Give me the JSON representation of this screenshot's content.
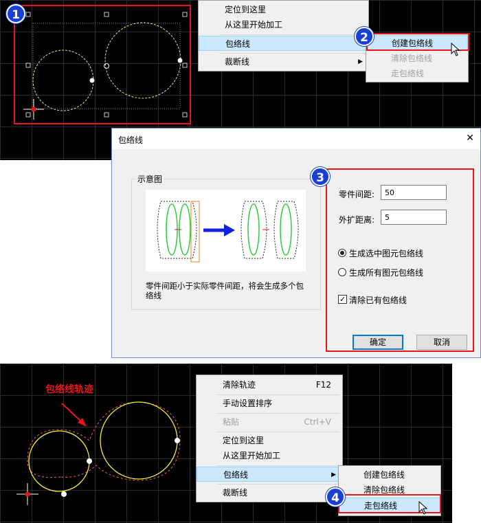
{
  "badges": [
    "1",
    "2",
    "3",
    "4"
  ],
  "top_menu": {
    "items": [
      {
        "label": "定位到这里"
      },
      {
        "label": "从这里开始加工"
      },
      {
        "label": "包络线"
      },
      {
        "label": "裁断线"
      }
    ]
  },
  "top_submenu": {
    "items": [
      {
        "label": "创建包络线"
      },
      {
        "label": "清除包络线"
      },
      {
        "label": "走包络线"
      }
    ]
  },
  "dialog": {
    "title": "包络线",
    "close_glyph": "✕",
    "group_title": "示意图",
    "note": "零件间距小于实际零件间距，将会生成多个包络线",
    "spacing_label": "零件间距:",
    "spacing_value": "50",
    "expand_label": "外扩距离:",
    "expand_value": "5",
    "radio1": "生成选中图元包络线",
    "radio2": "生成所有图元包络线",
    "checkbox": "清除已有包络线",
    "ok": "确定",
    "cancel": "取消"
  },
  "annotation": "包络线轨迹",
  "bottom_menu": {
    "items": [
      {
        "label": "清除轨迹",
        "shortcut": "F12"
      },
      {
        "label": "手动设置排序"
      },
      {
        "label": "粘贴",
        "shortcut": "Ctrl+V"
      },
      {
        "label": "定位到这里"
      },
      {
        "label": "从这里开始加工"
      },
      {
        "label": "包络线"
      },
      {
        "label": "裁断线"
      }
    ]
  },
  "bottom_submenu": {
    "items": [
      {
        "label": "创建包络线"
      },
      {
        "label": "清除包络线"
      },
      {
        "label": "走包络线"
      }
    ]
  },
  "colors": {
    "accent_blue": "#1a3fd4",
    "highlight_red": "#e8141b",
    "canvas": "#000000"
  }
}
